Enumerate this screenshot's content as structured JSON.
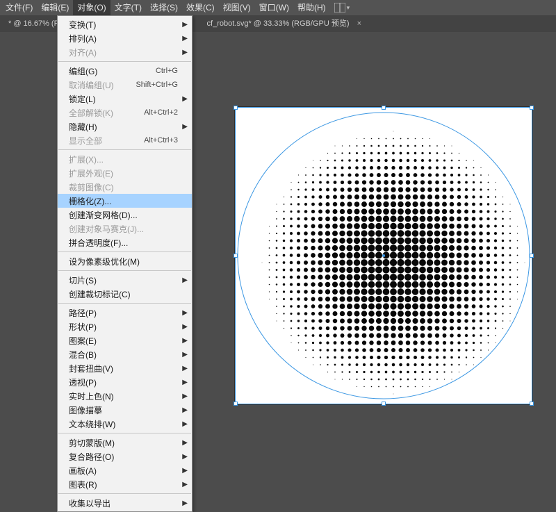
{
  "menubar": {
    "items": [
      {
        "label": "文件(F)"
      },
      {
        "label": "编辑(E)"
      },
      {
        "label": "对象(O)",
        "active": true
      },
      {
        "label": "文字(T)"
      },
      {
        "label": "选择(S)"
      },
      {
        "label": "效果(C)"
      },
      {
        "label": "视图(V)"
      },
      {
        "label": "窗口(W)"
      },
      {
        "label": "帮助(H)"
      }
    ]
  },
  "tabs": {
    "left": {
      "label": "* @ 16.67% (R",
      "close": ""
    },
    "right": {
      "label": "cf_robot.svg* @ 33.33% (RGB/GPU 预览)",
      "close": "×"
    }
  },
  "dropdown": {
    "groups": [
      [
        {
          "label": "变换(T)",
          "submenu": true
        },
        {
          "label": "排列(A)",
          "submenu": true
        },
        {
          "label": "对齐(A)",
          "submenu": true,
          "disabled": true
        }
      ],
      [
        {
          "label": "编组(G)",
          "accel": "Ctrl+G"
        },
        {
          "label": "取消编组(U)",
          "accel": "Shift+Ctrl+G",
          "disabled": true
        },
        {
          "label": "锁定(L)",
          "submenu": true
        },
        {
          "label": "全部解锁(K)",
          "accel": "Alt+Ctrl+2",
          "disabled": true
        },
        {
          "label": "隐藏(H)",
          "submenu": true
        },
        {
          "label": "显示全部",
          "accel": "Alt+Ctrl+3",
          "disabled": true
        }
      ],
      [
        {
          "label": "扩展(X)...",
          "disabled": true
        },
        {
          "label": "扩展外观(E)",
          "disabled": true
        },
        {
          "label": "裁剪图像(C)",
          "disabled": true
        },
        {
          "label": "栅格化(Z)...",
          "highlight": true
        },
        {
          "label": "创建渐变网格(D)..."
        },
        {
          "label": "创建对象马赛克(J)...",
          "disabled": true
        },
        {
          "label": "拼合透明度(F)..."
        }
      ],
      [
        {
          "label": "设为像素级优化(M)"
        }
      ],
      [
        {
          "label": "切片(S)",
          "submenu": true
        },
        {
          "label": "创建裁切标记(C)"
        }
      ],
      [
        {
          "label": "路径(P)",
          "submenu": true
        },
        {
          "label": "形状(P)",
          "submenu": true
        },
        {
          "label": "图案(E)",
          "submenu": true
        },
        {
          "label": "混合(B)",
          "submenu": true
        },
        {
          "label": "封套扭曲(V)",
          "submenu": true
        },
        {
          "label": "透视(P)",
          "submenu": true
        },
        {
          "label": "实时上色(N)",
          "submenu": true
        },
        {
          "label": "图像描摹",
          "submenu": true
        },
        {
          "label": "文本绕排(W)",
          "submenu": true
        }
      ],
      [
        {
          "label": "剪切蒙版(M)",
          "submenu": true
        },
        {
          "label": "复合路径(O)",
          "submenu": true
        },
        {
          "label": "画板(A)",
          "submenu": true
        },
        {
          "label": "图表(R)",
          "submenu": true
        }
      ],
      [
        {
          "label": "收集以导出",
          "submenu": true
        }
      ]
    ]
  }
}
